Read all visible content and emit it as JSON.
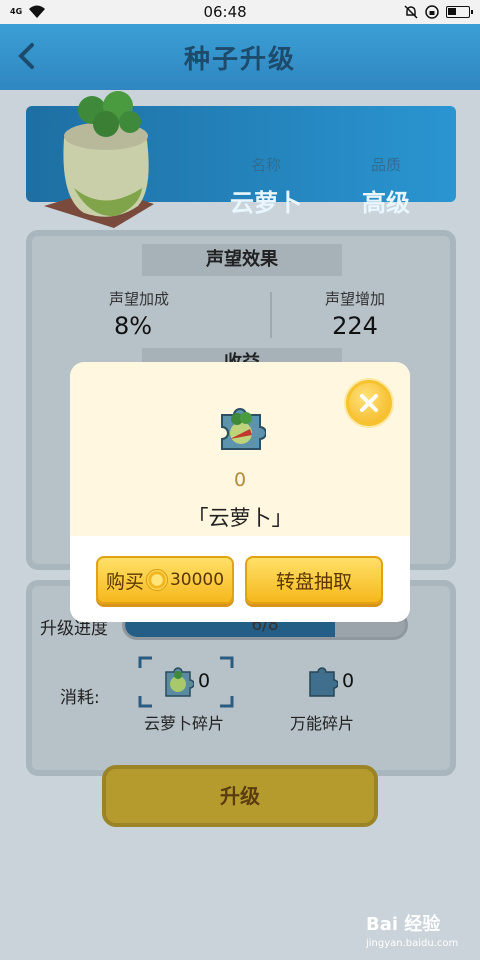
{
  "status_bar": {
    "signal": "4G",
    "time": "06:48"
  },
  "header": {
    "title": "种子升级"
  },
  "seed": {
    "name_label": "名称",
    "name_value": "云萝卜",
    "quality_label": "品质",
    "quality_value": "高级"
  },
  "prestige": {
    "title": "声望效果",
    "bonus_label": "声望加成",
    "bonus_value": "8%",
    "increase_label": "声望增加",
    "increase_value": "224",
    "next_title": "收益"
  },
  "upgrade": {
    "progress_label": "升级进度",
    "progress_text": "6/8",
    "progress_current": 6,
    "progress_total": 8,
    "cost_label": "消耗:",
    "cost_items": [
      {
        "name": "云萝卜碎片",
        "count": "0"
      },
      {
        "name": "万能碎片",
        "count": "0"
      }
    ],
    "button_label": "升级"
  },
  "modal": {
    "piece_count": "0",
    "piece_name": "「云萝卜」",
    "buy_label": "购买",
    "buy_price": "30000",
    "wheel_label": "转盘抽取"
  },
  "watermark": {
    "brand": "Bai 经验",
    "url": "jingyan.baidu.com"
  },
  "colors": {
    "accent_blue": "#2f86c0",
    "gold": "#f6b81d",
    "modal_bg": "#fff7df"
  }
}
